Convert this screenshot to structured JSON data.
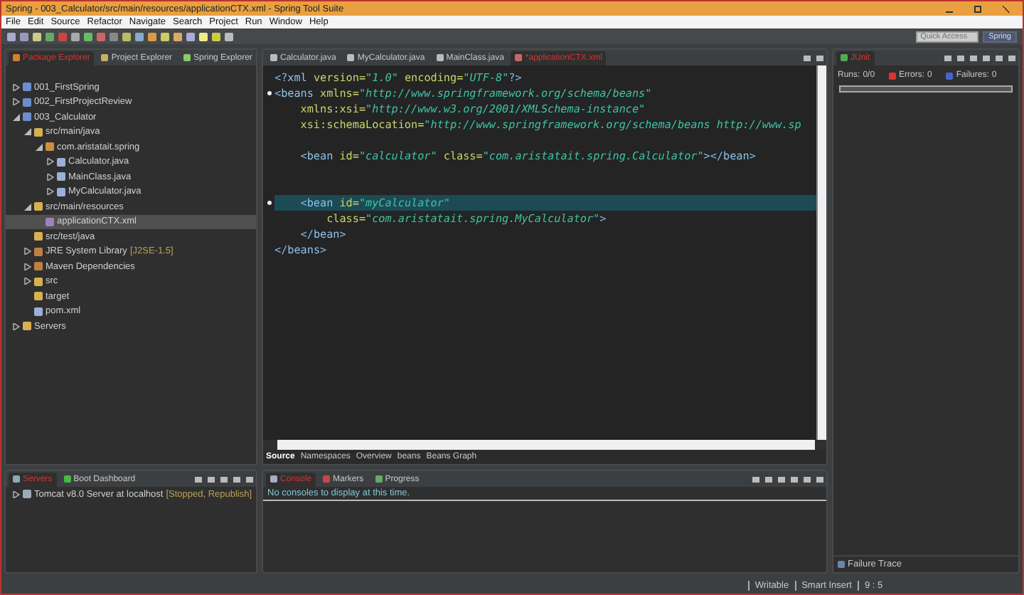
{
  "window": {
    "title": "Spring - 003_Calculator/src/main/resources/applicationCTX.xml - Spring Tool Suite"
  },
  "menu": [
    "File",
    "Edit",
    "Source",
    "Refactor",
    "Navigate",
    "Search",
    "Project",
    "Run",
    "Window",
    "Help"
  ],
  "quick_access": {
    "placeholder": "Quick Access"
  },
  "perspective": {
    "label": "Spring",
    "selected": true
  },
  "explorer": {
    "tabs": [
      {
        "label": "Package Explorer",
        "selected": true
      },
      {
        "label": "Project Explorer",
        "selected": false
      },
      {
        "label": "Spring Explorer",
        "selected": false
      }
    ],
    "tree": [
      {
        "label": "001_FirstSpring",
        "kind": "project",
        "expanded": false,
        "selected": false
      },
      {
        "label": "002_FirstProjectReview",
        "kind": "project",
        "expanded": false,
        "selected": false
      },
      {
        "label": "003_Calculator",
        "kind": "project",
        "expanded": true,
        "selected": false,
        "children": [
          {
            "label": "src/main/java",
            "kind": "folder",
            "expanded": true,
            "selected": false,
            "children": [
              {
                "label": "com.aristatait.spring",
                "kind": "package",
                "expanded": true,
                "selected": false,
                "children": [
                  {
                    "label": "Calculator.java",
                    "kind": "file",
                    "expanded": false,
                    "selected": false
                  },
                  {
                    "label": "MainClass.java",
                    "kind": "file",
                    "expanded": false,
                    "selected": false
                  },
                  {
                    "label": "MyCalculator.java",
                    "kind": "file",
                    "expanded": false,
                    "selected": false
                  }
                ]
              }
            ]
          },
          {
            "label": "src/main/resources",
            "kind": "folder",
            "expanded": true,
            "selected": false,
            "children": [
              {
                "label": "applicationCTX.xml",
                "kind": "xml",
                "selected": true
              }
            ]
          },
          {
            "label": "src/test/java",
            "kind": "folder",
            "selected": false
          },
          {
            "label": "JRE System Library",
            "decoration": "[J2SE-1.5]",
            "kind": "library",
            "expanded": false,
            "selected": false
          },
          {
            "label": "Maven Dependencies",
            "kind": "library",
            "expanded": false,
            "selected": false
          },
          {
            "label": "src",
            "kind": "folder",
            "expanded": false,
            "selected": false
          },
          {
            "label": "target",
            "kind": "folder",
            "selected": false
          },
          {
            "label": "pom.xml",
            "kind": "file",
            "selected": false
          }
        ]
      },
      {
        "label": "Servers",
        "kind": "folder",
        "expanded": false,
        "selected": false
      }
    ]
  },
  "editor": {
    "tabs": [
      {
        "label": "Calculator.java",
        "selected": false
      },
      {
        "label": "MyCalculator.java",
        "selected": false
      },
      {
        "label": "MainClass.java",
        "selected": false
      },
      {
        "label": "*applicationCTX.xml",
        "selected": true
      }
    ],
    "lines": [
      {
        "current": false,
        "marker": false,
        "tokens": [
          {
            "kind": "bracket",
            "text": "<?"
          },
          {
            "kind": "tag",
            "text": "xml "
          },
          {
            "kind": "attr",
            "text": "version"
          },
          {
            "kind": "eq",
            "text": "="
          },
          {
            "kind": "value",
            "text": "\"1.0\""
          },
          {
            "kind": "attr",
            "text": " encoding"
          },
          {
            "kind": "eq",
            "text": "="
          },
          {
            "kind": "value",
            "text": "\"UTF-8\""
          },
          {
            "kind": "bracket",
            "text": "?>"
          }
        ]
      },
      {
        "current": false,
        "marker": true,
        "tokens": [
          {
            "kind": "bracket",
            "text": "<"
          },
          {
            "kind": "tag",
            "text": "beans "
          },
          {
            "kind": "attr",
            "text": "xmlns"
          },
          {
            "kind": "eq",
            "text": "="
          },
          {
            "kind": "value",
            "text": "\"http://www.springframework.org/schema/beans\""
          }
        ]
      },
      {
        "current": false,
        "marker": false,
        "tokens": [
          {
            "kind": "attr",
            "text": "    xmlns:xsi"
          },
          {
            "kind": "eq",
            "text": "="
          },
          {
            "kind": "value",
            "text": "\"http://www.w3.org/2001/XMLSchema-instance\""
          }
        ]
      },
      {
        "current": false,
        "marker": false,
        "tokens": [
          {
            "kind": "attr",
            "text": "    xsi:schemaLocation"
          },
          {
            "kind": "eq",
            "text": "="
          },
          {
            "kind": "value",
            "text": "\"http://www.springframework.org/schema/beans http://www.sp"
          }
        ]
      },
      {
        "current": false,
        "marker": false
      },
      {
        "current": false,
        "marker": false,
        "tokens": [
          {
            "kind": "bracket",
            "text": "    <"
          },
          {
            "kind": "tag",
            "text": "bean "
          },
          {
            "kind": "attr",
            "text": "id"
          },
          {
            "kind": "eq",
            "text": "="
          },
          {
            "kind": "value",
            "text": "\"calculator\""
          },
          {
            "kind": "attr",
            "text": " class"
          },
          {
            "kind": "eq",
            "text": "="
          },
          {
            "kind": "value",
            "text": "\"com.aristatait.spring.Calculator\""
          },
          {
            "kind": "bracket",
            "text": "></"
          },
          {
            "kind": "tag",
            "text": "bean"
          },
          {
            "kind": "bracket",
            "text": ">"
          }
        ]
      },
      {
        "current": false,
        "marker": false
      },
      {
        "current": false,
        "marker": false
      },
      {
        "current": true,
        "marker": true,
        "tokens": [
          {
            "kind": "bracket",
            "text": "    <"
          },
          {
            "kind": "tag",
            "text": "bean "
          },
          {
            "kind": "attr",
            "text": "id"
          },
          {
            "kind": "eq",
            "text": "="
          },
          {
            "kind": "value",
            "text": "\"myCalculator\""
          }
        ]
      },
      {
        "current": false,
        "marker": false,
        "tokens": [
          {
            "kind": "attr",
            "text": "        class"
          },
          {
            "kind": "eq",
            "text": "="
          },
          {
            "kind": "value",
            "text": "\"com.aristatait.spring.MyCalculator\""
          },
          {
            "kind": "bracket",
            "text": ">"
          }
        ]
      },
      {
        "current": false,
        "marker": false,
        "tokens": [
          {
            "kind": "bracket",
            "text": "    </"
          },
          {
            "kind": "tag",
            "text": "bean"
          },
          {
            "kind": "bracket",
            "text": ">"
          }
        ]
      },
      {
        "current": false,
        "marker": false,
        "tokens": [
          {
            "kind": "bracket",
            "text": "</"
          },
          {
            "kind": "tag",
            "text": "beans"
          },
          {
            "kind": "bracket",
            "text": ">"
          }
        ]
      }
    ],
    "bottom_tabs": [
      {
        "label": "Source",
        "selected": true
      },
      {
        "label": "Namespaces",
        "selected": false
      },
      {
        "label": "Overview",
        "selected": false
      },
      {
        "label": "beans",
        "selected": false
      },
      {
        "label": "Beans Graph",
        "selected": false
      }
    ]
  },
  "junit": {
    "tab": {
      "label": "JUnit",
      "selected": true
    },
    "runs_label": "Runs:",
    "runs": "0/0",
    "errors_label": "Errors:",
    "errors": "0",
    "failures_label": "Failures:",
    "failures": "0",
    "failure_trace": "Failure Trace"
  },
  "servers": {
    "tabs": [
      {
        "label": "Servers",
        "selected": true
      },
      {
        "label": "Boot Dashboard",
        "selected": false
      }
    ],
    "items": [
      {
        "label": "Tomcat v8.0 Server at localhost",
        "state": "[Stopped, Republish]",
        "expanded": false
      }
    ]
  },
  "console": {
    "tabs": [
      {
        "label": "Console",
        "selected": true
      },
      {
        "label": "Markers",
        "selected": false
      },
      {
        "label": "Progress",
        "selected": false
      }
    ],
    "message": "No consoles to display at this time."
  },
  "status_bar": [
    "Writable",
    "Smart Insert",
    "9 : 5"
  ]
}
